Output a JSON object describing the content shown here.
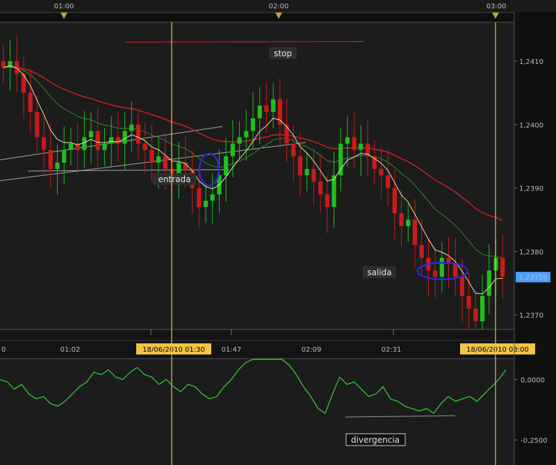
{
  "chart_data": [
    {
      "type": "candlestick",
      "x_top_labels": [
        "01:00",
        "02:00",
        "03:00"
      ],
      "x_bottom_labels": [
        "0",
        "01:02",
        "18/06/2010 01:30",
        "01:47",
        "02:09",
        "02:31",
        "18/06/2010 03:00"
      ],
      "ylim": [
        1.2366,
        1.2416
      ],
      "y_tick_labels": [
        "1,2410",
        "1,2400",
        "1,2390",
        "1,2380",
        "1,2370"
      ],
      "y_ticks": [
        1.241,
        1.24,
        1.239,
        1.238,
        1.237
      ],
      "last_price_label": "1,23759",
      "last_price": 1.23759,
      "annotations": [
        {
          "text": "stop",
          "price": 1.24125
        },
        {
          "text": "entrada",
          "price": 1.2391
        },
        {
          "text": "salida",
          "price": 1.2378
        }
      ],
      "stop_price": 1.2413,
      "close_series": [
        1.2409,
        1.241,
        1.2408,
        1.2405,
        1.2402,
        1.2398,
        1.2396,
        1.2393,
        1.2394,
        1.2396,
        1.2397,
        1.2396,
        1.2398,
        1.2399,
        1.2396,
        1.2397,
        1.2398,
        1.2397,
        1.2399,
        1.24,
        1.2397,
        1.2396,
        1.2394,
        1.2395,
        1.2393,
        1.2392,
        1.2394,
        1.2393,
        1.239,
        1.2387,
        1.2388,
        1.2389,
        1.2392,
        1.2395,
        1.2397,
        1.2398,
        1.2399,
        1.2401,
        1.2403,
        1.2402,
        1.2404,
        1.24,
        1.2397,
        1.2395,
        1.2392,
        1.2393,
        1.2391,
        1.2389,
        1.2387,
        1.2392,
        1.2397,
        1.2398,
        1.2396,
        1.2397,
        1.2395,
        1.2393,
        1.2392,
        1.239,
        1.2386,
        1.2384,
        1.2385,
        1.2381,
        1.2379,
        1.2377,
        1.2376,
        1.2379,
        1.2378,
        1.2376,
        1.2373,
        1.2371,
        1.2369,
        1.2373,
        1.2377,
        1.2379,
        1.2376
      ]
    },
    {
      "type": "line",
      "name": "oscillator",
      "y_tick_labels": [
        "0,0000",
        "-0,2500"
      ],
      "y_ticks": [
        0,
        -0.25
      ],
      "ylim": [
        -0.33,
        0.09
      ],
      "annotation": "divergencia",
      "values": [
        0.0,
        -0.01,
        -0.04,
        -0.02,
        -0.06,
        -0.08,
        -0.07,
        -0.1,
        -0.11,
        -0.09,
        -0.06,
        -0.03,
        -0.01,
        0.03,
        0.02,
        0.04,
        0.01,
        0.0,
        0.03,
        0.05,
        0.02,
        0.01,
        -0.02,
        0.0,
        -0.03,
        -0.05,
        -0.02,
        -0.03,
        -0.06,
        -0.08,
        -0.07,
        -0.03,
        0.0,
        0.04,
        0.07,
        0.09,
        0.09,
        0.09,
        0.09,
        0.09,
        0.06,
        0.02,
        -0.03,
        -0.07,
        -0.12,
        -0.14,
        -0.06,
        0.01,
        -0.02,
        -0.01,
        -0.04,
        -0.07,
        -0.06,
        -0.03,
        -0.08,
        -0.09,
        -0.11,
        -0.12,
        -0.13,
        -0.12,
        -0.14,
        -0.1,
        -0.07,
        -0.09,
        -0.08,
        -0.07,
        -0.09,
        -0.06,
        -0.03,
        0.0,
        0.04
      ]
    }
  ],
  "colors": {
    "background": "#0f0f0f",
    "grid": "#3a3a3a",
    "bull": "#1fbf1f",
    "bear": "#cc1a1a",
    "ma_fast": "#e9e5a0",
    "ma_mid": "#2f8f2f",
    "ma_slow": "#cc2222",
    "marker_line": "#f0c040",
    "date_highlight": "#f2c544",
    "price_tag": "#4a9fff",
    "oscillator": "#33d633"
  }
}
